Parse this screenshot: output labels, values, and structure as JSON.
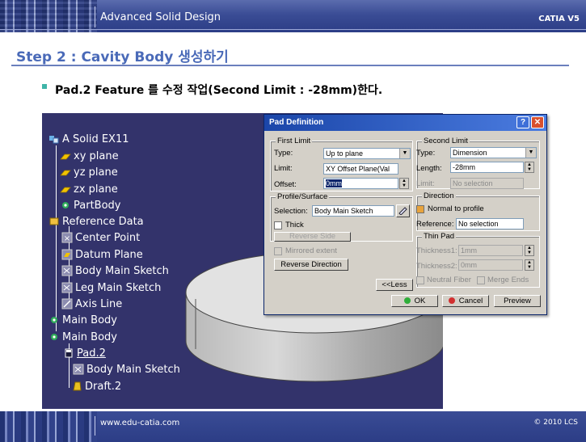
{
  "header": {
    "title": "Advanced Solid Design",
    "brand": "CATIA V5"
  },
  "footer": {
    "url": "www.edu-catia.com",
    "copyright": "© 2010 LCS"
  },
  "step_title": "Step 2 : Cavity Body 생성하기",
  "instruction": "Pad.2 Feature 를 수정 작업(Second Limit : -28mm)한다.",
  "tree": {
    "root": "A Solid EX11",
    "xy": "xy plane",
    "yz": "yz plane",
    "zx": "zx plane",
    "partbody": "PartBody",
    "refdata": "Reference Data",
    "center": "Center Point",
    "datum": "Datum Plane",
    "bodysketch": "Body Main Sketch",
    "legsketch": "Leg Main Sketch",
    "axis": "Axis Line",
    "mainbody1": "Main Body",
    "mainbody2": "Main Body",
    "pad2": "Pad.2",
    "padsketch": "Body Main Sketch",
    "draft2": "Draft.2"
  },
  "dialog": {
    "title": "Pad Definition",
    "first_limit": {
      "group": "First Limit",
      "type_label": "Type:",
      "type_value": "Up to plane",
      "limit_label": "Limit:",
      "limit_value": "XY Offset Plane(Val",
      "offset_label": "Offset:",
      "offset_value": "0mm"
    },
    "profile": {
      "group": "Profile/Surface",
      "selection_label": "Selection:",
      "selection_value": "Body Main Sketch",
      "thick": "Thick",
      "reverse_side": "Reverse Side"
    },
    "mirrored": "Mirrored extent",
    "reverse_direction": "Reverse Direction",
    "second_limit": {
      "group": "Second Limit",
      "type_label": "Type:",
      "type_value": "Dimension",
      "length_label": "Length:",
      "length_value": "-28mm",
      "limit_label": "Limit:",
      "limit_value": "No selection"
    },
    "direction": {
      "group": "Direction",
      "normal": "Normal to profile",
      "reference_label": "Reference:",
      "reference_value": "No selection"
    },
    "thin_pad": {
      "group": "Thin Pad",
      "thickness1_label": "Thickness1:",
      "thickness1_value": "1mm",
      "thickness2_label": "Thickness2:",
      "thickness2_value": "0mm",
      "neutral": "Neutral Fiber",
      "merge": "Merge Ends"
    },
    "less": "<<Less",
    "ok": "OK",
    "cancel": "Cancel",
    "preview": "Preview"
  }
}
